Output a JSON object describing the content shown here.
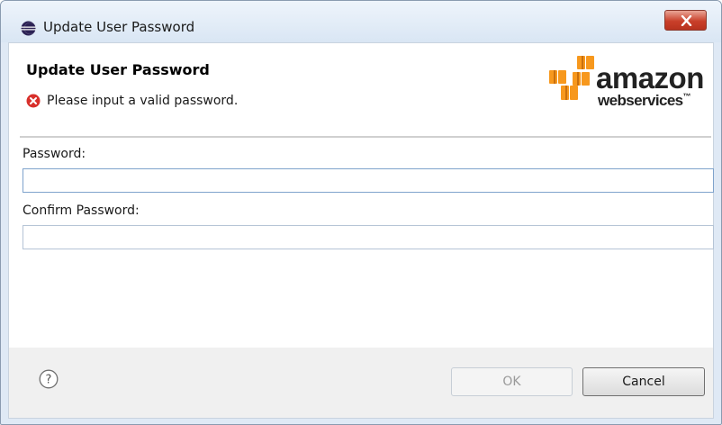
{
  "window": {
    "title": "Update User Password",
    "close_label": "X"
  },
  "header": {
    "title": "Update User Password",
    "error_message": "Please input a valid password.",
    "logo": {
      "line1": "amazon",
      "line2": "webservices",
      "trademark": "™",
      "brand_color": "#f7981d"
    }
  },
  "form": {
    "password_label": "Password:",
    "password_value": "",
    "confirm_label": "Confirm Password:",
    "confirm_value": ""
  },
  "footer": {
    "help_symbol": "?",
    "ok_label": "OK",
    "ok_enabled": false,
    "cancel_label": "Cancel"
  },
  "colors": {
    "error": "#d8302b",
    "titlebar": "#dfe9f5",
    "close_button": "#c9402a"
  }
}
